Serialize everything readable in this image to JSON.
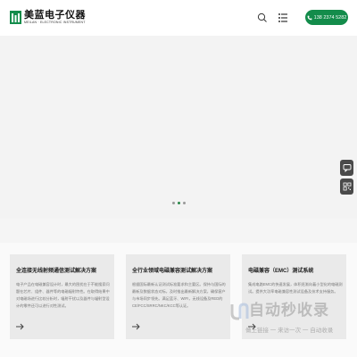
{
  "header": {
    "logo_name": "美蓝电子仪器",
    "logo_sub": "MEILAN · ELECTRONIC INSTRUMENT",
    "phone": "138 2374 5282"
  },
  "hero": {
    "slides": 3,
    "active_slide": 2
  },
  "side_tools": [
    "chat-icon",
    "qrcode-icon"
  ],
  "cards": [
    {
      "title": "全连接无线射频通信测试解决方案",
      "body": "电子产品在电磁兼容设计时，最大的困扰在于不能搜索问题在芯片、组件、器件等的电磁辐射特性。在取得结果中对电磁场进行比较分析时，辐射干扰以及器件与辐射型设计的零件还可以进行对性测试。"
    },
    {
      "title": "全行业领域电磁兼容测试解决方案",
      "body": "根据国际最新认证测试标准要求和主要区。保持与国际的最新及数据状态对标，及时推出最新解决方案，确保客户与市场同步领先。满足蓝牙、WIFI，无线设备及RED的CE/FCC/SRRC/NKC/KCC等认证。"
    },
    {
      "title": "电磁兼容（EMC）测试系统",
      "body": "集成电路EMC的快速发展，体积逐渐向着小型化的电磁测试。提供大功率电磁兼容性测试设备及技术支持服务。"
    }
  ],
  "watermark": {
    "big": "自动秒收录",
    "small": "做上链接 一 来访一次 一 自动收录"
  },
  "colors": {
    "brand_green": "#138c4b",
    "side_button": "#4a4a4a"
  }
}
